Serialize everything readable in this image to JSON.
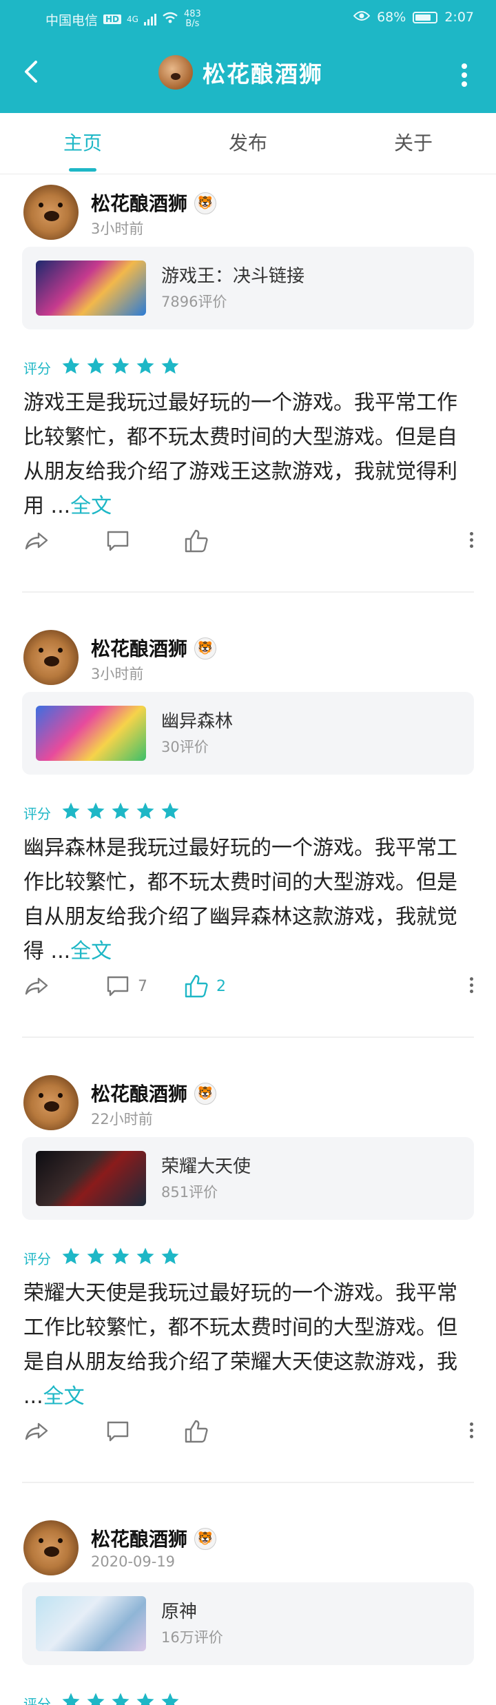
{
  "status_bar": {
    "carrier": "中国电信",
    "hd": "HD",
    "network": "4G",
    "speed_value": "483",
    "speed_unit": "B/s",
    "battery": "68%",
    "time": "2:07"
  },
  "header": {
    "title": "松花酿酒狮"
  },
  "tabs": [
    {
      "label": "主页",
      "active": true
    },
    {
      "label": "发布",
      "active": false
    },
    {
      "label": "关于",
      "active": false
    }
  ],
  "posts": [
    {
      "author": "松花酿酒狮",
      "time": "3小时前",
      "game": {
        "name": "游戏王：决斗链接",
        "reviews": "7896评价"
      },
      "rating_label": "评分",
      "stars": 5,
      "text": "游戏王是我玩过最好玩的一个游戏。我平常工作比较繁忙，都不玩太费时间的大型游戏。但是自从朋友给我介绍了游戏王这款游戏，我就觉得利用 ...",
      "full_link": "全文",
      "comments": "",
      "likes": ""
    },
    {
      "author": "松花酿酒狮",
      "time": "3小时前",
      "game": {
        "name": "幽异森林",
        "reviews": "30评价"
      },
      "rating_label": "评分",
      "stars": 5,
      "text": "幽异森林是我玩过最好玩的一个游戏。我平常工作比较繁忙，都不玩太费时间的大型游戏。但是自从朋友给我介绍了幽异森林这款游戏，我就觉得 ...",
      "full_link": "全文",
      "comments": "7",
      "likes": "2"
    },
    {
      "author": "松花酿酒狮",
      "time": "22小时前",
      "game": {
        "name": "荣耀大天使",
        "reviews": "851评价"
      },
      "rating_label": "评分",
      "stars": 5,
      "text": "荣耀大天使是我玩过最好玩的一个游戏。我平常工作比较繁忙，都不玩太费时间的大型游戏。但是自从朋友给我介绍了荣耀大天使这款游戏，我 ...",
      "full_link": "全文",
      "comments": "",
      "likes": ""
    },
    {
      "author": "松花酿酒狮",
      "time": "2020-09-19",
      "game": {
        "name": "原神",
        "reviews": "16万评价"
      },
      "rating_label": "评分",
      "stars": 5,
      "text": "",
      "full_link": "",
      "comments": "",
      "likes": ""
    }
  ],
  "colors": {
    "accent": "#1eb7c6",
    "header_bg": "#1eb7c6",
    "card_bg": "#f4f5f7"
  },
  "icons": [
    "back-arrow-icon",
    "more-vertical-icon",
    "share-icon",
    "comment-icon",
    "like-icon",
    "star-icon",
    "badge-icon"
  ]
}
